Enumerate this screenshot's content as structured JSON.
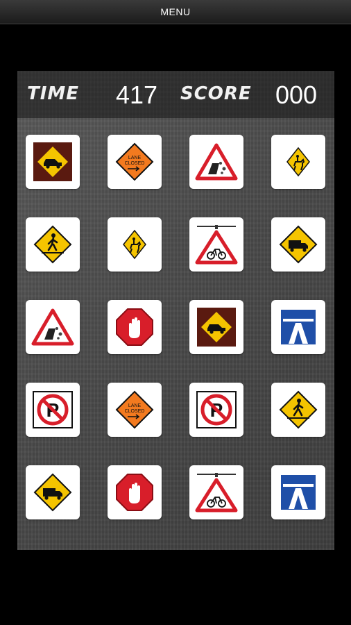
{
  "menu": {
    "label": "MENU"
  },
  "hud": {
    "time_label": "TIME",
    "time_value": "417",
    "score_label": "SCORE",
    "score_value": "000"
  },
  "tiles": [
    "car-sign-icon",
    "lane-closed-sign-icon",
    "falling-rocks-sign-icon",
    "horse-rider-sign-icon",
    "pedestrian-crossing-sign-icon",
    "horse-rider-sign-icon",
    "cycle-route-sign-icon",
    "truck-sign-icon",
    "falling-rocks-sign-icon",
    "stop-hand-sign-icon",
    "car-sign-icon",
    "motorway-sign-icon",
    "no-parking-sign-icon",
    "lane-closed-sign-icon",
    "no-parking-sign-icon",
    "pedestrian-crossing-sign-icon",
    "truck-sign-icon",
    "stop-hand-sign-icon",
    "cycle-route-sign-icon",
    "motorway-sign-icon"
  ],
  "sign_text": {
    "lane_closed_line1": "LANE",
    "lane_closed_line2": "CLOSED"
  },
  "colors": {
    "warning_yellow": "#f5c400",
    "orange": "#f37a1f",
    "red": "#d81e2a",
    "blue": "#1f4fa8",
    "maroon": "#5a1a10"
  }
}
